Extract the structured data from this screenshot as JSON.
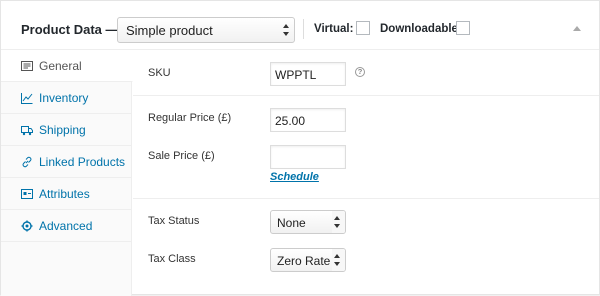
{
  "header": {
    "title": "Product Data —",
    "product_type": "Simple product",
    "virtual_label": "Virtual:",
    "downloadable_label": "Downloadable:"
  },
  "sidebar": {
    "items": [
      {
        "label": "General",
        "icon": "general-icon",
        "active": true
      },
      {
        "label": "Inventory",
        "icon": "inventory-icon",
        "active": false
      },
      {
        "label": "Shipping",
        "icon": "truck-icon",
        "active": false
      },
      {
        "label": "Linked Products",
        "icon": "link-icon",
        "active": false
      },
      {
        "label": "Attributes",
        "icon": "attributes-icon",
        "active": false
      },
      {
        "label": "Advanced",
        "icon": "gear-icon",
        "active": false
      }
    ]
  },
  "fields": {
    "sku_label": "SKU",
    "sku_value": "WPPTL",
    "regular_price_label": "Regular Price (£)",
    "regular_price_value": "25.00",
    "sale_price_label": "Sale Price (£)",
    "sale_price_value": "",
    "schedule_link": "Schedule",
    "tax_status_label": "Tax Status",
    "tax_status_value": "None",
    "tax_class_label": "Tax Class",
    "tax_class_value": "Zero Rate"
  },
  "colors": {
    "link": "#0073aa",
    "border": "#e5e5e5"
  }
}
